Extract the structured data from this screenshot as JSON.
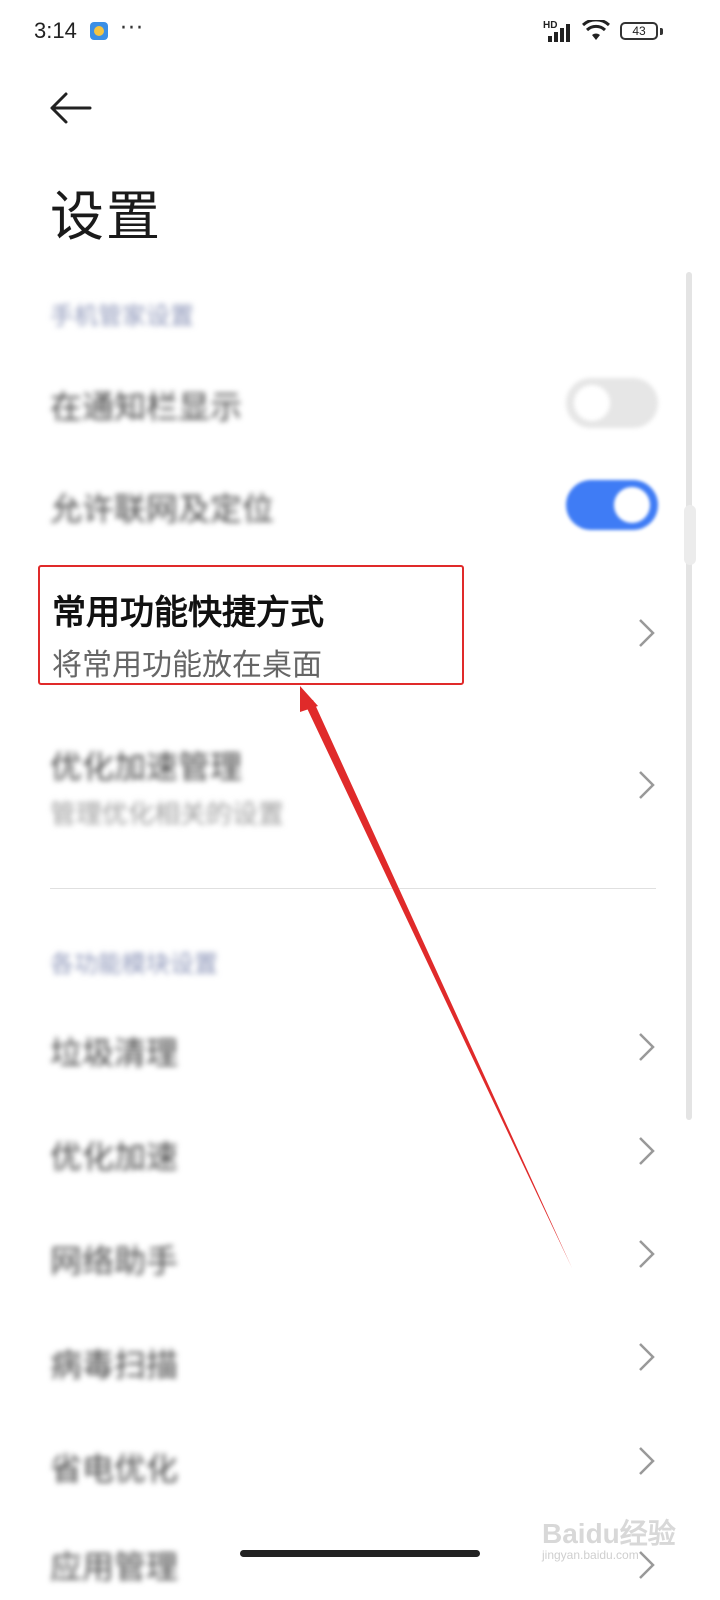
{
  "status_bar": {
    "time": "3:14",
    "more": "···",
    "network": "HD",
    "battery": "43"
  },
  "page": {
    "title": "设置"
  },
  "section1": {
    "header": "手机管家设置",
    "items": [
      {
        "title": "在通知栏显示",
        "toggle": false
      },
      {
        "title": "允许联网及定位",
        "toggle": true
      }
    ]
  },
  "highlighted_item": {
    "title": "常用功能快捷方式",
    "subtitle": "将常用功能放在桌面"
  },
  "optimize_item": {
    "title": "优化加速管理",
    "subtitle": "管理优化相关的设置"
  },
  "section2": {
    "header": "各功能模块设置",
    "items": [
      {
        "title": "垃圾清理"
      },
      {
        "title": "优化加速"
      },
      {
        "title": "网络助手"
      },
      {
        "title": "病毒扫描"
      },
      {
        "title": "省电优化"
      },
      {
        "title": "应用管理"
      }
    ]
  },
  "colors": {
    "accent": "#3f7cf5",
    "annotation": "#e02a2a"
  },
  "watermark": {
    "brand": "Baidu经验",
    "site": "jingyan.baidu.com"
  }
}
